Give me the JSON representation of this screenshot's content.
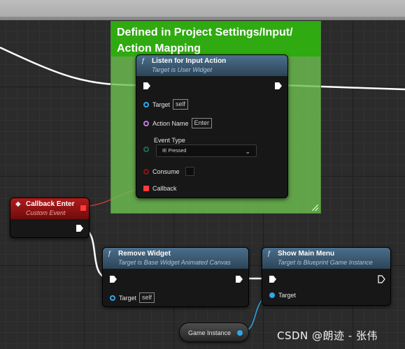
{
  "comment": {
    "title": "Defined in Project Settings/Input/ Action Mapping",
    "color": "#2faa10"
  },
  "nodes": {
    "listen": {
      "icon": "function-icon",
      "title": "Listen for Input Action",
      "subtitle": "Target is User Widget",
      "target_label": "Target",
      "target_value": "self",
      "action_name_label": "Action Name",
      "action_name_value": "Enter",
      "event_type_label": "Event Type",
      "event_type_value": "IE Pressed",
      "consume_label": "Consume",
      "callback_label": "Callback"
    },
    "callback": {
      "icon": "event-diamond-icon",
      "title": "Callback Enter",
      "subtitle": "Custom Event",
      "color": "#b21a1a"
    },
    "remove_widget": {
      "icon": "function-icon",
      "title": "Remove Widget",
      "subtitle": "Target is Base Widget Animated Canvas",
      "target_label": "Target",
      "target_value": "self"
    },
    "show_menu": {
      "icon": "function-icon",
      "title": "Show Main Menu",
      "subtitle": "Target is Blueprint Game Instance",
      "target_label": "Target"
    },
    "game_instance": {
      "label": "Game Instance"
    }
  },
  "colors": {
    "object_pin": "#2ea8e8",
    "string_pin": "#c57ade",
    "byte_pin": "#1e6b4c",
    "bool_pin": "#8a1515",
    "delegate_pin": "#ff3b3b",
    "exec_wire": "#ffffff"
  },
  "watermark": "CSDN @朗迹 - 张伟"
}
